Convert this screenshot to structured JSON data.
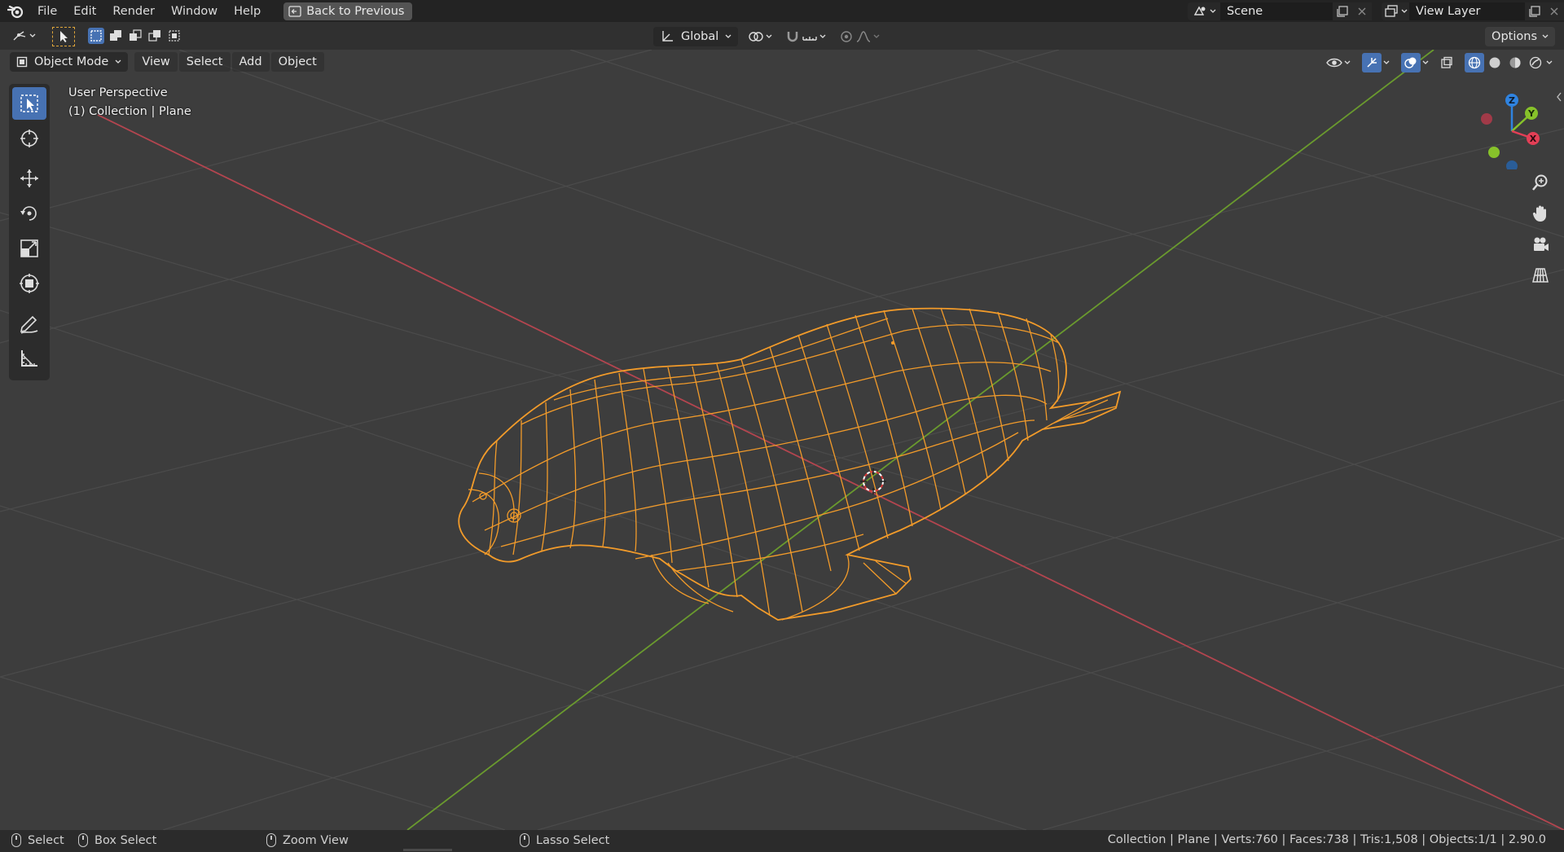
{
  "menubar": {
    "items": [
      "File",
      "Edit",
      "Render",
      "Window",
      "Help"
    ],
    "back_button": "Back to Previous",
    "scene_name": "Scene",
    "view_layer": "View Layer"
  },
  "toolheader": {
    "orientation": "Global",
    "options_label": "Options"
  },
  "viewport_header": {
    "mode": "Object Mode",
    "menus": [
      "View",
      "Select",
      "Add",
      "Object"
    ]
  },
  "view_info": {
    "perspective": "User Perspective",
    "collection": "(1) Collection | Plane"
  },
  "toolbar": {
    "tools": [
      "select-box-tool",
      "cursor-tool",
      "move-tool",
      "rotate-tool",
      "scale-tool",
      "transform-tool",
      "annotate-tool",
      "measure-tool"
    ]
  },
  "gizmo": {
    "axes": {
      "x": "X",
      "y": "Y",
      "z": "Z"
    },
    "colors": {
      "x": "#e33f56",
      "y": "#87c22a",
      "z": "#2f83e0"
    }
  },
  "statusbar": {
    "hints": [
      "Select",
      "Box Select",
      "Zoom View",
      "Lasso Select"
    ],
    "stats": "Collection | Plane | Verts:760 | Faces:738 | Tris:1,508 | Objects:1/1 | 2.90.0"
  },
  "colors": {
    "accent": "#4772b3",
    "selection": "#f29b2a",
    "x_axis": "#b3454f",
    "y_axis": "#6a9a2e"
  }
}
